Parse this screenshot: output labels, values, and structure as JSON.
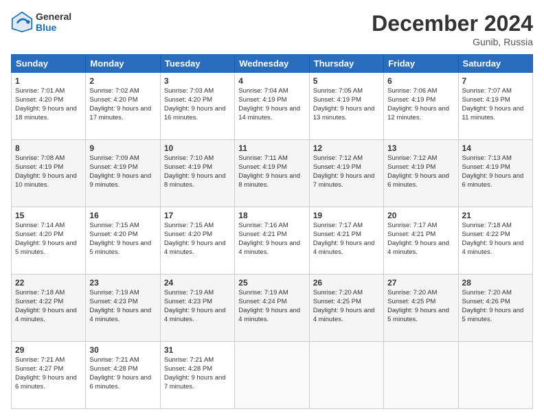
{
  "header": {
    "logo_line1": "General",
    "logo_line2": "Blue",
    "title": "December 2024",
    "location": "Gunib, Russia"
  },
  "days_of_week": [
    "Sunday",
    "Monday",
    "Tuesday",
    "Wednesday",
    "Thursday",
    "Friday",
    "Saturday"
  ],
  "weeks": [
    [
      {
        "day": 1,
        "sunrise": "7:01 AM",
        "sunset": "4:20 PM",
        "daylight": "9 hours and 18 minutes."
      },
      {
        "day": 2,
        "sunrise": "7:02 AM",
        "sunset": "4:20 PM",
        "daylight": "9 hours and 17 minutes."
      },
      {
        "day": 3,
        "sunrise": "7:03 AM",
        "sunset": "4:20 PM",
        "daylight": "9 hours and 16 minutes."
      },
      {
        "day": 4,
        "sunrise": "7:04 AM",
        "sunset": "4:19 PM",
        "daylight": "9 hours and 14 minutes."
      },
      {
        "day": 5,
        "sunrise": "7:05 AM",
        "sunset": "4:19 PM",
        "daylight": "9 hours and 13 minutes."
      },
      {
        "day": 6,
        "sunrise": "7:06 AM",
        "sunset": "4:19 PM",
        "daylight": "9 hours and 12 minutes."
      },
      {
        "day": 7,
        "sunrise": "7:07 AM",
        "sunset": "4:19 PM",
        "daylight": "9 hours and 11 minutes."
      }
    ],
    [
      {
        "day": 8,
        "sunrise": "7:08 AM",
        "sunset": "4:19 PM",
        "daylight": "9 hours and 10 minutes."
      },
      {
        "day": 9,
        "sunrise": "7:09 AM",
        "sunset": "4:19 PM",
        "daylight": "9 hours and 9 minutes."
      },
      {
        "day": 10,
        "sunrise": "7:10 AM",
        "sunset": "4:19 PM",
        "daylight": "9 hours and 8 minutes."
      },
      {
        "day": 11,
        "sunrise": "7:11 AM",
        "sunset": "4:19 PM",
        "daylight": "9 hours and 8 minutes."
      },
      {
        "day": 12,
        "sunrise": "7:12 AM",
        "sunset": "4:19 PM",
        "daylight": "9 hours and 7 minutes."
      },
      {
        "day": 13,
        "sunrise": "7:12 AM",
        "sunset": "4:19 PM",
        "daylight": "9 hours and 6 minutes."
      },
      {
        "day": 14,
        "sunrise": "7:13 AM",
        "sunset": "4:19 PM",
        "daylight": "9 hours and 6 minutes."
      }
    ],
    [
      {
        "day": 15,
        "sunrise": "7:14 AM",
        "sunset": "4:20 PM",
        "daylight": "9 hours and 5 minutes."
      },
      {
        "day": 16,
        "sunrise": "7:15 AM",
        "sunset": "4:20 PM",
        "daylight": "9 hours and 5 minutes."
      },
      {
        "day": 17,
        "sunrise": "7:15 AM",
        "sunset": "4:20 PM",
        "daylight": "9 hours and 4 minutes."
      },
      {
        "day": 18,
        "sunrise": "7:16 AM",
        "sunset": "4:21 PM",
        "daylight": "9 hours and 4 minutes."
      },
      {
        "day": 19,
        "sunrise": "7:17 AM",
        "sunset": "4:21 PM",
        "daylight": "9 hours and 4 minutes."
      },
      {
        "day": 20,
        "sunrise": "7:17 AM",
        "sunset": "4:21 PM",
        "daylight": "9 hours and 4 minutes."
      },
      {
        "day": 21,
        "sunrise": "7:18 AM",
        "sunset": "4:22 PM",
        "daylight": "9 hours and 4 minutes."
      }
    ],
    [
      {
        "day": 22,
        "sunrise": "7:18 AM",
        "sunset": "4:22 PM",
        "daylight": "9 hours and 4 minutes."
      },
      {
        "day": 23,
        "sunrise": "7:19 AM",
        "sunset": "4:23 PM",
        "daylight": "9 hours and 4 minutes."
      },
      {
        "day": 24,
        "sunrise": "7:19 AM",
        "sunset": "4:23 PM",
        "daylight": "9 hours and 4 minutes."
      },
      {
        "day": 25,
        "sunrise": "7:19 AM",
        "sunset": "4:24 PM",
        "daylight": "9 hours and 4 minutes."
      },
      {
        "day": 26,
        "sunrise": "7:20 AM",
        "sunset": "4:25 PM",
        "daylight": "9 hours and 4 minutes."
      },
      {
        "day": 27,
        "sunrise": "7:20 AM",
        "sunset": "4:25 PM",
        "daylight": "9 hours and 5 minutes."
      },
      {
        "day": 28,
        "sunrise": "7:20 AM",
        "sunset": "4:26 PM",
        "daylight": "9 hours and 5 minutes."
      }
    ],
    [
      {
        "day": 29,
        "sunrise": "7:21 AM",
        "sunset": "4:27 PM",
        "daylight": "9 hours and 6 minutes."
      },
      {
        "day": 30,
        "sunrise": "7:21 AM",
        "sunset": "4:28 PM",
        "daylight": "9 hours and 6 minutes."
      },
      {
        "day": 31,
        "sunrise": "7:21 AM",
        "sunset": "4:28 PM",
        "daylight": "9 hours and 7 minutes."
      },
      null,
      null,
      null,
      null
    ]
  ]
}
